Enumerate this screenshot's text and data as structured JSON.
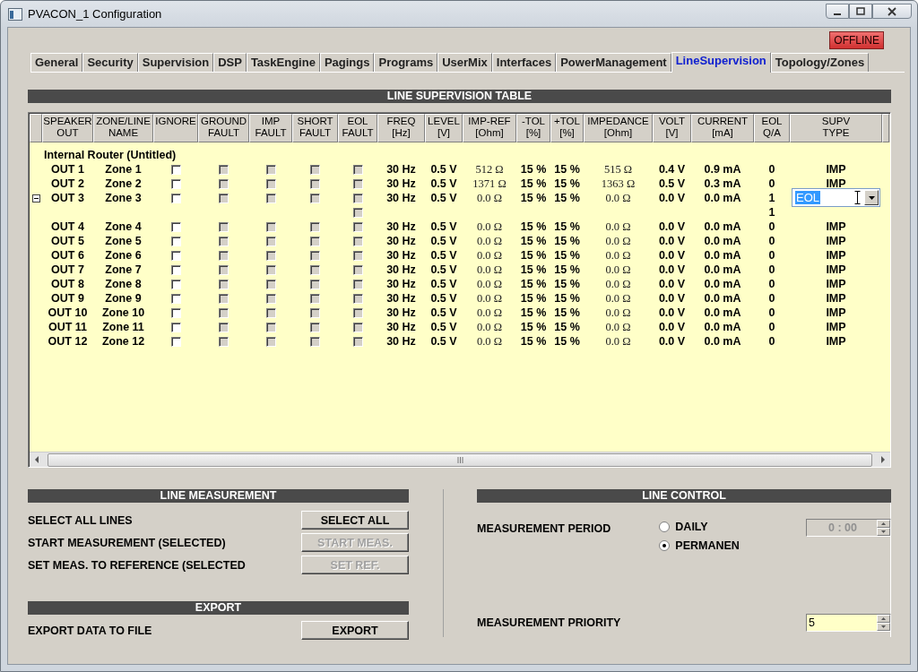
{
  "window": {
    "title": "PVACON_1 Configuration"
  },
  "status_badge": {
    "text": "OFFLINE"
  },
  "tabs": [
    {
      "label": "General",
      "selected": false
    },
    {
      "label": "Security",
      "selected": false
    },
    {
      "label": "Supervision",
      "selected": false
    },
    {
      "label": "DSP",
      "selected": false
    },
    {
      "label": "TaskEngine",
      "selected": false
    },
    {
      "label": "Pagings",
      "selected": false
    },
    {
      "label": "Programs",
      "selected": false
    },
    {
      "label": "UserMix",
      "selected": false
    },
    {
      "label": "Interfaces",
      "selected": false
    },
    {
      "label": "PowerManagement",
      "selected": false
    },
    {
      "label": "LineSupervision",
      "selected": true
    },
    {
      "label": "Topology/Zones",
      "selected": false
    }
  ],
  "line_supervision_table": {
    "title": "LINE SUPERVISION TABLE",
    "fault_checks_disabled": true,
    "columns": [
      "SPEAKER\nOUT",
      "ZONE/LINE\nNAME",
      "IGNORE",
      "GROUND\nFAULT",
      "IMP\nFAULT",
      "SHORT\nFAULT",
      "EOL\nFAULT",
      "FREQ\n[Hz]",
      "LEVEL\n[V]",
      "IMP-REF\n[Ohm]",
      "-TOL\n[%]",
      "+TOL\n[%]",
      "IMPEDANCE\n[Ohm]",
      "VOLT\n[V]",
      "CURRENT\n[mA]",
      "EOL\nQ/A",
      "SUPV\nTYPE"
    ],
    "group": "Internal Router (Untitled)",
    "rows": [
      {
        "out": "OUT 1",
        "zone": "Zone 1",
        "ignore": false,
        "ground_fault": false,
        "imp_fault": false,
        "short_fault": false,
        "eol_fault": false,
        "freq": "30 Hz",
        "level": "0.5 V",
        "imp_ref": "512 Ω",
        "tol_minus": "15 %",
        "tol_plus": "15 %",
        "impedance": "515 Ω",
        "volt": "0.4 V",
        "current": "0.9 mA",
        "eol_qa": "0",
        "supv_type": "IMP",
        "editing": false
      },
      {
        "out": "OUT 2",
        "zone": "Zone 2",
        "ignore": false,
        "ground_fault": false,
        "imp_fault": false,
        "short_fault": false,
        "eol_fault": false,
        "freq": "30 Hz",
        "level": "0.5 V",
        "imp_ref": "1371 Ω",
        "tol_minus": "15 %",
        "tol_plus": "15 %",
        "impedance": "1363 Ω",
        "volt": "0.5 V",
        "current": "0.3 mA",
        "eol_qa": "0",
        "supv_type": "IMP",
        "editing": false
      },
      {
        "out": "OUT 3",
        "zone": "Zone 3",
        "ignore": false,
        "ground_fault": false,
        "imp_fault": false,
        "short_fault": false,
        "eol_fault": false,
        "freq": "30 Hz",
        "level": "0.5 V",
        "imp_ref": "0.0 Ω",
        "tol_minus": "15 %",
        "tol_plus": "15 %",
        "impedance": "0.0 Ω",
        "volt": "0.0 V",
        "current": "0.0 mA",
        "eol_qa": "1",
        "supv_type": "EOL",
        "editing": true,
        "expanded": true,
        "children": [
          {
            "eol_fault": false,
            "eol_qa": "1"
          }
        ]
      },
      {
        "out": "OUT 4",
        "zone": "Zone 4",
        "ignore": false,
        "ground_fault": false,
        "imp_fault": false,
        "short_fault": false,
        "eol_fault": false,
        "freq": "30 Hz",
        "level": "0.5 V",
        "imp_ref": "0.0 Ω",
        "tol_minus": "15 %",
        "tol_plus": "15 %",
        "impedance": "0.0 Ω",
        "volt": "0.0 V",
        "current": "0.0 mA",
        "eol_qa": "0",
        "supv_type": "IMP",
        "editing": false
      },
      {
        "out": "OUT 5",
        "zone": "Zone 5",
        "ignore": false,
        "ground_fault": false,
        "imp_fault": false,
        "short_fault": false,
        "eol_fault": false,
        "freq": "30 Hz",
        "level": "0.5 V",
        "imp_ref": "0.0 Ω",
        "tol_minus": "15 %",
        "tol_plus": "15 %",
        "impedance": "0.0 Ω",
        "volt": "0.0 V",
        "current": "0.0 mA",
        "eol_qa": "0",
        "supv_type": "IMP",
        "editing": false
      },
      {
        "out": "OUT 6",
        "zone": "Zone 6",
        "ignore": false,
        "ground_fault": false,
        "imp_fault": false,
        "short_fault": false,
        "eol_fault": false,
        "freq": "30 Hz",
        "level": "0.5 V",
        "imp_ref": "0.0 Ω",
        "tol_minus": "15 %",
        "tol_plus": "15 %",
        "impedance": "0.0 Ω",
        "volt": "0.0 V",
        "current": "0.0 mA",
        "eol_qa": "0",
        "supv_type": "IMP",
        "editing": false
      },
      {
        "out": "OUT 7",
        "zone": "Zone 7",
        "ignore": false,
        "ground_fault": false,
        "imp_fault": false,
        "short_fault": false,
        "eol_fault": false,
        "freq": "30 Hz",
        "level": "0.5 V",
        "imp_ref": "0.0 Ω",
        "tol_minus": "15 %",
        "tol_plus": "15 %",
        "impedance": "0.0 Ω",
        "volt": "0.0 V",
        "current": "0.0 mA",
        "eol_qa": "0",
        "supv_type": "IMP",
        "editing": false
      },
      {
        "out": "OUT 8",
        "zone": "Zone 8",
        "ignore": false,
        "ground_fault": false,
        "imp_fault": false,
        "short_fault": false,
        "eol_fault": false,
        "freq": "30 Hz",
        "level": "0.5 V",
        "imp_ref": "0.0 Ω",
        "tol_minus": "15 %",
        "tol_plus": "15 %",
        "impedance": "0.0 Ω",
        "volt": "0.0 V",
        "current": "0.0 mA",
        "eol_qa": "0",
        "supv_type": "IMP",
        "editing": false
      },
      {
        "out": "OUT 9",
        "zone": "Zone 9",
        "ignore": false,
        "ground_fault": false,
        "imp_fault": false,
        "short_fault": false,
        "eol_fault": false,
        "freq": "30 Hz",
        "level": "0.5 V",
        "imp_ref": "0.0 Ω",
        "tol_minus": "15 %",
        "tol_plus": "15 %",
        "impedance": "0.0 Ω",
        "volt": "0.0 V",
        "current": "0.0 mA",
        "eol_qa": "0",
        "supv_type": "IMP",
        "editing": false
      },
      {
        "out": "OUT 10",
        "zone": "Zone 10",
        "ignore": false,
        "ground_fault": false,
        "imp_fault": false,
        "short_fault": false,
        "eol_fault": false,
        "freq": "30 Hz",
        "level": "0.5 V",
        "imp_ref": "0.0 Ω",
        "tol_minus": "15 %",
        "tol_plus": "15 %",
        "impedance": "0.0 Ω",
        "volt": "0.0 V",
        "current": "0.0 mA",
        "eol_qa": "0",
        "supv_type": "IMP",
        "editing": false
      },
      {
        "out": "OUT 11",
        "zone": "Zone 11",
        "ignore": false,
        "ground_fault": false,
        "imp_fault": false,
        "short_fault": false,
        "eol_fault": false,
        "freq": "30 Hz",
        "level": "0.5 V",
        "imp_ref": "0.0 Ω",
        "tol_minus": "15 %",
        "tol_plus": "15 %",
        "impedance": "0.0 Ω",
        "volt": "0.0 V",
        "current": "0.0 mA",
        "eol_qa": "0",
        "supv_type": "IMP",
        "editing": false
      },
      {
        "out": "OUT 12",
        "zone": "Zone 12",
        "ignore": false,
        "ground_fault": false,
        "imp_fault": false,
        "short_fault": false,
        "eol_fault": false,
        "freq": "30 Hz",
        "level": "0.5 V",
        "imp_ref": "0.0 Ω",
        "tol_minus": "15 %",
        "tol_plus": "15 %",
        "impedance": "0.0 Ω",
        "volt": "0.0 V",
        "current": "0.0 mA",
        "eol_qa": "0",
        "supv_type": "IMP",
        "editing": false
      }
    ]
  },
  "line_measurement": {
    "title": "LINE MEASUREMENT",
    "actions": [
      {
        "label": "SELECT ALL LINES",
        "button": "SELECT ALL",
        "disabled": false
      },
      {
        "label": "START MEASUREMENT (SELECTED)",
        "button": "START MEAS.",
        "disabled": true
      },
      {
        "label": "SET MEAS. TO REFERENCE (SELECTED",
        "button": "SET REF.",
        "disabled": true
      }
    ]
  },
  "export": {
    "title": "EXPORT",
    "label": "EXPORT DATA TO FILE",
    "button": "EXPORT"
  },
  "line_control": {
    "title": "LINE CONTROL",
    "period_label": "MEASUREMENT PERIOD",
    "period_options": [
      {
        "label": "DAILY",
        "selected": false
      },
      {
        "label": "PERMANEN",
        "selected": true
      }
    ],
    "time": {
      "value": "0 : 00",
      "disabled": true
    },
    "priority_label": "MEASUREMENT PRIORITY",
    "priority": {
      "value": "5"
    }
  }
}
